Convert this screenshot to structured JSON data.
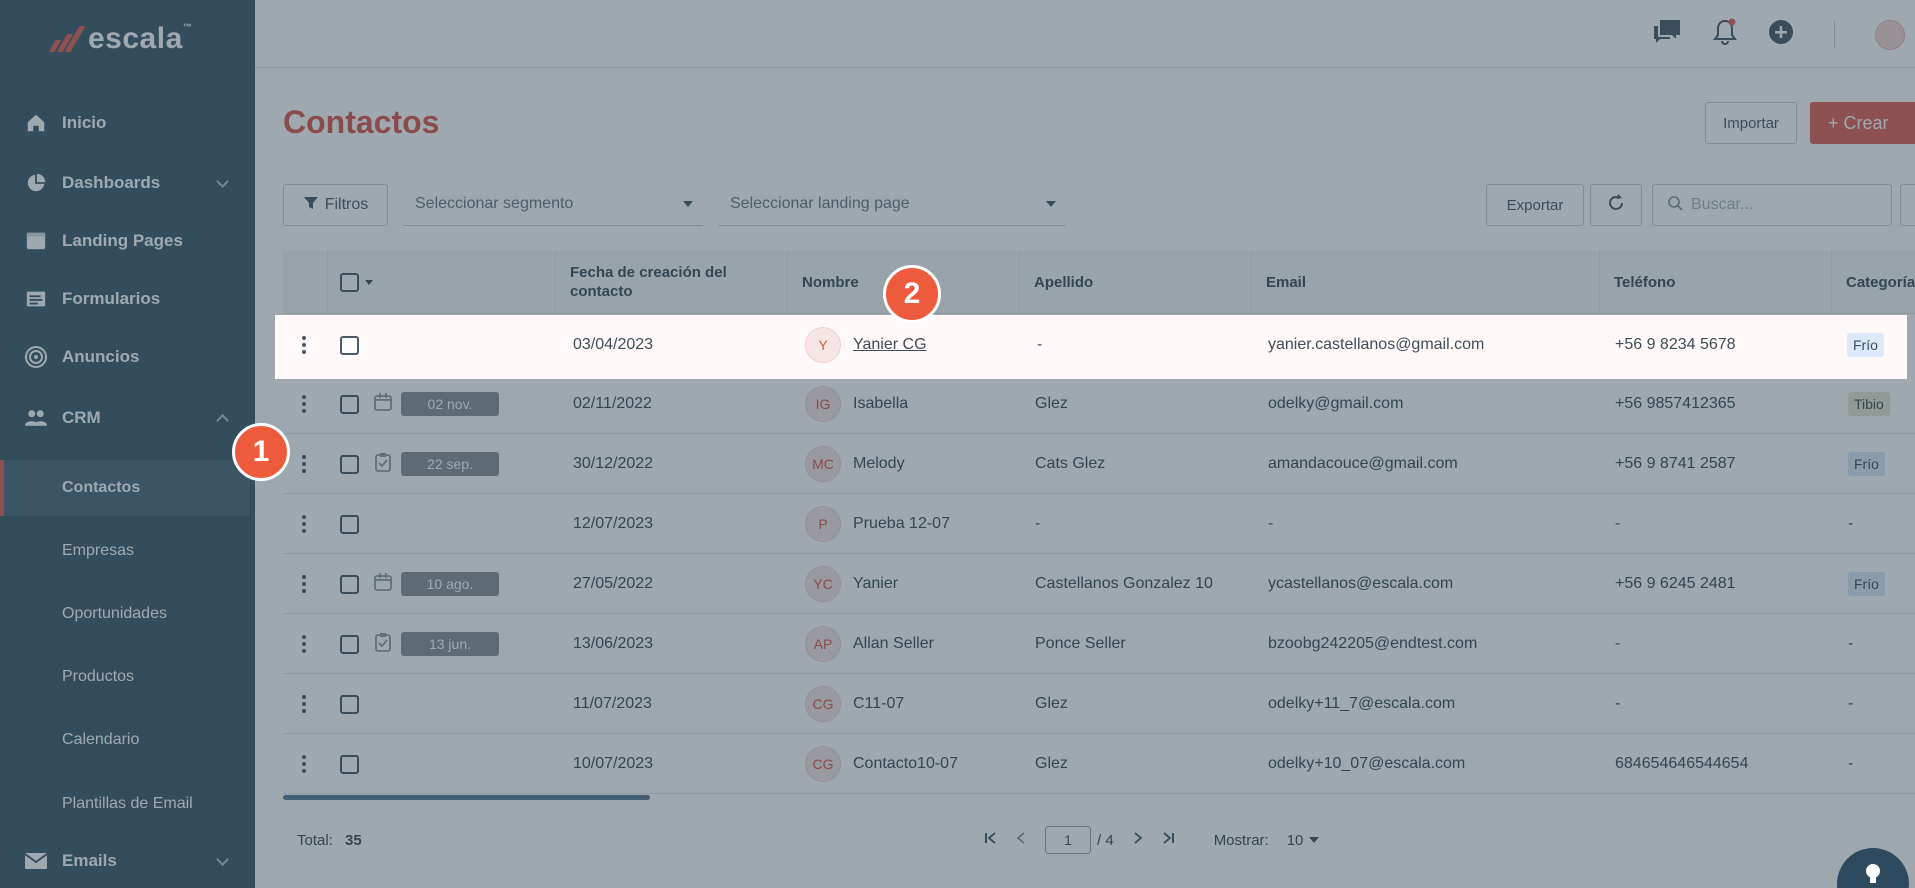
{
  "app": {
    "logo_text": "escala",
    "logo_tm": "™"
  },
  "sidebar": {
    "items": [
      {
        "label": "Inicio",
        "icon": "home-icon"
      },
      {
        "label": "Dashboards",
        "icon": "pie-chart-icon"
      },
      {
        "label": "Landing Pages",
        "icon": "window-icon"
      },
      {
        "label": "Formularios",
        "icon": "form-icon"
      },
      {
        "label": "Anuncios",
        "icon": "target-icon"
      },
      {
        "label": "CRM",
        "icon": "users-icon"
      },
      {
        "label": "Emails",
        "icon": "mail-icon"
      }
    ],
    "crm_sub": [
      "Contactos",
      "Empresas",
      "Oportunidades",
      "Productos",
      "Calendario",
      "Plantillas de Email"
    ]
  },
  "page": {
    "title": "Contactos",
    "import_label": "Importar",
    "create_label": "+ Crear",
    "filters_label": "Filtros",
    "segment_placeholder": "Seleccionar segmento",
    "landing_placeholder": "Seleccionar landing page",
    "export_label": "Exportar",
    "search_placeholder": "Buscar..."
  },
  "table": {
    "headers": [
      "Fecha de creación del contacto",
      "Nombre",
      "Apellido",
      "Email",
      "Teléfono",
      "Categoría"
    ],
    "rows": [
      {
        "task": "",
        "fecha": "03/04/2023",
        "initials": "Y",
        "nombre": "Yanier CG",
        "apellido": "-",
        "email": "yanier.castellanos@gmail.com",
        "telefono": "+56 9 8234 5678",
        "categoria": "Frío",
        "cat_type": "cold"
      },
      {
        "task": "02 nov.",
        "task_icon": "calendar-icon",
        "fecha": "02/11/2022",
        "initials": "IG",
        "nombre": "Isabella",
        "apellido": "Glez",
        "email": "odelky@gmail.com",
        "telefono": "+56 9857412365",
        "categoria": "Tibio",
        "cat_type": "warm"
      },
      {
        "task": "22 sep.",
        "task_icon": "clipboard-check-icon",
        "fecha": "30/12/2022",
        "initials": "MC",
        "nombre": "Melody",
        "apellido": "Cats Glez",
        "email": "amandacouce@gmail.com",
        "telefono": "+56 9 8741 2587",
        "categoria": "Frío",
        "cat_type": "cold"
      },
      {
        "task": "",
        "fecha": "12/07/2023",
        "initials": "P",
        "nombre": "Prueba 12-07",
        "apellido": "-",
        "email": "-",
        "telefono": "-",
        "categoria": "-",
        "cat_type": "none"
      },
      {
        "task": "10 ago.",
        "task_icon": "calendar-icon",
        "fecha": "27/05/2022",
        "initials": "YC",
        "nombre": "Yanier",
        "apellido": "Castellanos Gonzalez 10",
        "email": "ycastellanos@escala.com",
        "telefono": "+56 9 6245 2481",
        "categoria": "Frío",
        "cat_type": "cold"
      },
      {
        "task": "13 jun.",
        "task_icon": "clipboard-check-icon",
        "fecha": "13/06/2023",
        "initials": "AP",
        "nombre": "Allan Seller",
        "apellido": "Ponce Seller",
        "email": "bzoobg242205@endtest.com",
        "telefono": "-",
        "categoria": "-",
        "cat_type": "none"
      },
      {
        "task": "",
        "fecha": "11/07/2023",
        "initials": "CG",
        "nombre": "C11-07",
        "apellido": "Glez",
        "email": "odelky+11_7@escala.com",
        "telefono": "-",
        "categoria": "-",
        "cat_type": "none"
      },
      {
        "task": "",
        "fecha": "10/07/2023",
        "initials": "CG",
        "nombre": "Contacto10-07",
        "apellido": "Glez",
        "email": "odelky+10_07@escala.com",
        "telefono": "684654646544654",
        "categoria": "-",
        "cat_type": "none"
      }
    ]
  },
  "footer": {
    "total_label": "Total:",
    "total_value": "35",
    "page_current": "1",
    "page_total": "/ 4",
    "show_label": "Mostrar:",
    "show_value": "10"
  },
  "steps": [
    "1",
    "2"
  ],
  "colors": {
    "accent": "#e06156",
    "sidebar": "#3e5a6c",
    "step": "#ee5b3c"
  }
}
